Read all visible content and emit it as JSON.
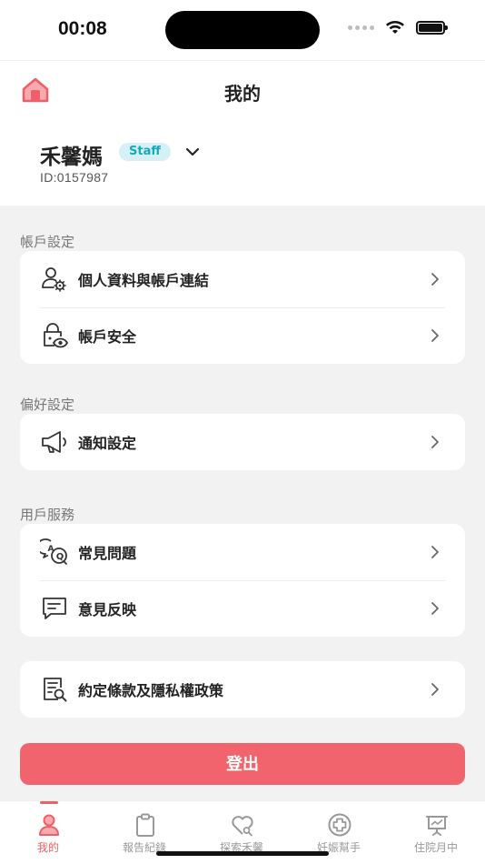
{
  "status_bar": {
    "time": "00:08"
  },
  "header": {
    "title": "我的",
    "user_name": "禾馨媽",
    "badge": "Staff",
    "user_id": "ID:0157987"
  },
  "sections": [
    {
      "title": "帳戶設定",
      "items": [
        {
          "label": "個人資料與帳戶連結",
          "icon": "user-settings-icon"
        },
        {
          "label": "帳戶安全",
          "icon": "lock-eye-icon"
        }
      ]
    },
    {
      "title": "偏好設定",
      "items": [
        {
          "label": "通知設定",
          "icon": "megaphone-icon"
        }
      ]
    },
    {
      "title": "用戶服務",
      "items": [
        {
          "label": "常見問題",
          "icon": "faq-bubbles-icon"
        },
        {
          "label": "意見反映",
          "icon": "message-icon"
        }
      ]
    }
  ],
  "terms": {
    "label": "約定條款及隱私權政策",
    "icon": "document-search-icon"
  },
  "logout_label": "登出",
  "tabs": [
    {
      "label": "我的",
      "icon": "person-icon",
      "active": true
    },
    {
      "label": "報告紀錄",
      "icon": "clipboard-icon",
      "active": false
    },
    {
      "label": "探索禾馨",
      "icon": "heart-search-icon",
      "active": false
    },
    {
      "label": "妊娠幫手",
      "icon": "medical-cross-icon",
      "active": false
    },
    {
      "label": "住院月中",
      "icon": "presentation-icon",
      "active": false
    }
  ],
  "colors": {
    "accent": "#f2646d",
    "badge_bg": "#d5f1f5",
    "badge_text": "#1aa7b8",
    "background": "#f2f2f3"
  }
}
